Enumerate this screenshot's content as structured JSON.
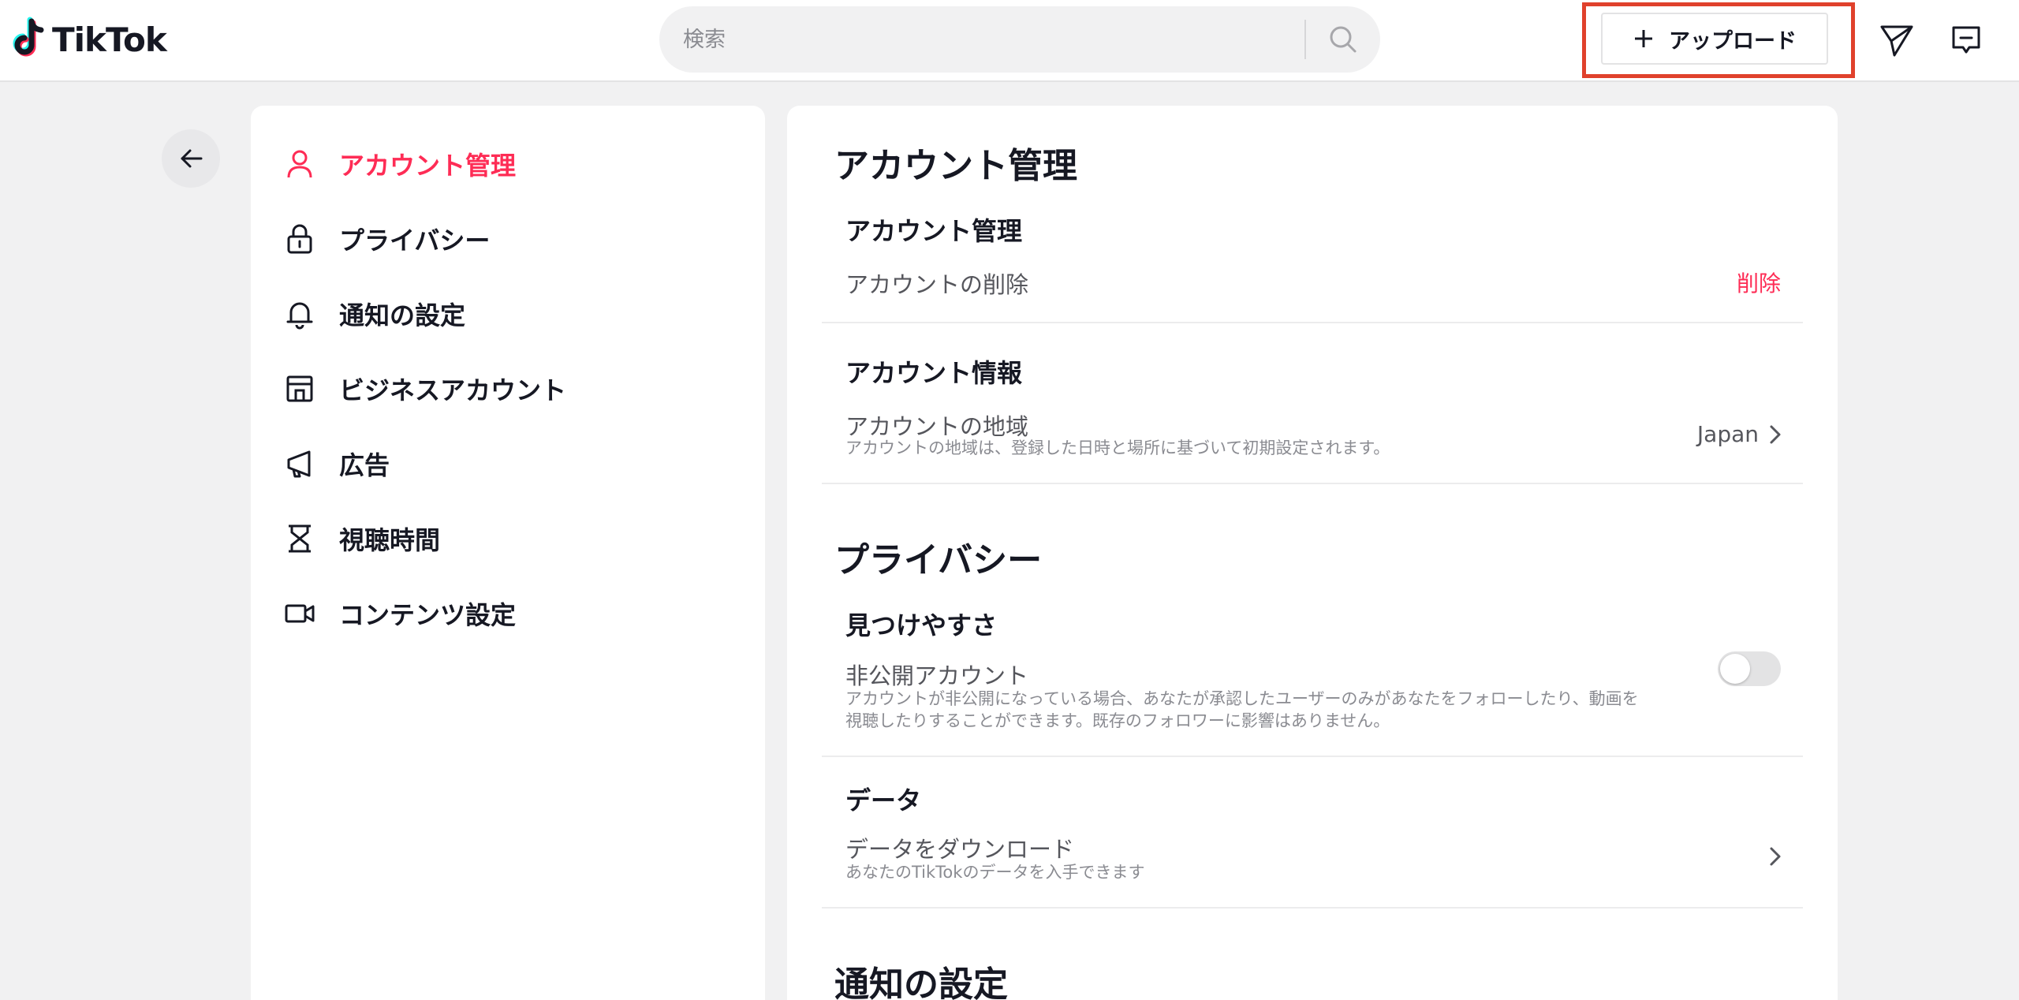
{
  "header": {
    "logo_text": "TikTok",
    "search_placeholder": "検索",
    "upload_label": "アップロード"
  },
  "sidebar": {
    "items": [
      {
        "label": "アカウント管理",
        "icon": "person-icon",
        "active": true
      },
      {
        "label": "プライバシー",
        "icon": "lock-icon"
      },
      {
        "label": "通知の設定",
        "icon": "bell-icon"
      },
      {
        "label": "ビジネスアカウント",
        "icon": "store-icon"
      },
      {
        "label": "広告",
        "icon": "megaphone-icon"
      },
      {
        "label": "視聴時間",
        "icon": "hourglass-icon"
      },
      {
        "label": "コンテンツ設定",
        "icon": "video-camera-icon"
      }
    ]
  },
  "main": {
    "account_section": {
      "title": "アカウント管理",
      "management": {
        "title": "アカウント管理",
        "delete_label": "アカウントの削除",
        "delete_action": "削除"
      },
      "info": {
        "title": "アカウント情報",
        "region_label": "アカウントの地域",
        "region_desc": "アカウントの地域は、登録した日時と場所に基づいて初期設定されます。",
        "region_value": "Japan"
      }
    },
    "privacy_section": {
      "title": "プライバシー",
      "discoverability": {
        "title": "見つけやすさ",
        "private_label": "非公開アカウント",
        "private_desc_line1": "アカウントが非公開になっている場合、あなたが承認したユーザーのみがあなたをフォローしたり、動画を",
        "private_desc_line2": "視聴したりすることができます。既存のフォロワーに影響はありません。",
        "private_enabled": false
      },
      "data": {
        "title": "データ",
        "download_label": "データをダウンロード",
        "download_desc": "あなたのTikTokのデータを入手できます"
      }
    },
    "notifications_section": {
      "title": "通知の設定"
    }
  },
  "colors": {
    "accent": "#fe2c55",
    "highlight_box": "#e0412c",
    "background": "#f1f1f2"
  }
}
